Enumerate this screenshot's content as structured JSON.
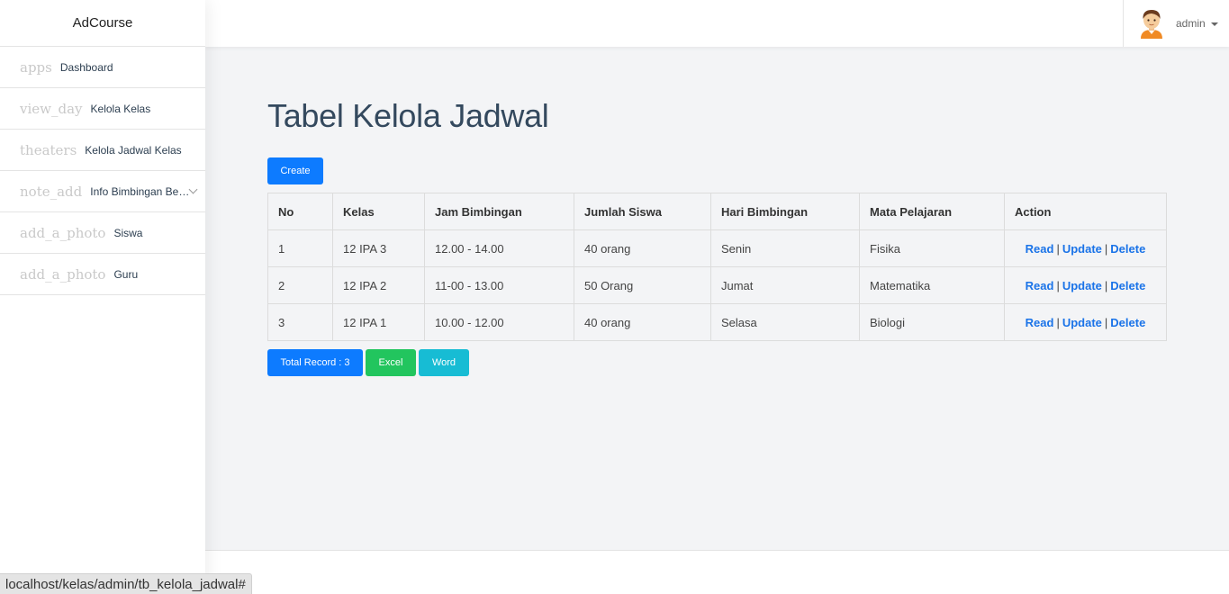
{
  "sidebar": {
    "brand": "AdCourse",
    "items": [
      {
        "icon": "apps",
        "label": "Dashboard"
      },
      {
        "icon": "view_day",
        "label": "Kelola Kelas"
      },
      {
        "icon": "theaters",
        "label": "Kelola Jadwal Kelas"
      },
      {
        "icon": "note_add",
        "label": "Info Bimbingan Belajar"
      },
      {
        "icon": "add_a_photo",
        "label": "Siswa"
      },
      {
        "icon": "add_a_photo",
        "label": "Guru"
      }
    ]
  },
  "topbar": {
    "user_name": "admin"
  },
  "main": {
    "title": "Tabel Kelola Jadwal",
    "create_label": "Create",
    "table": {
      "headers": [
        "No",
        "Kelas",
        "Jam Bimbingan",
        "Jumlah Siswa",
        "Hari Bimbingan",
        "Mata Pelajaran",
        "Action"
      ],
      "rows": [
        [
          "1",
          "12 IPA 3",
          "12.00 - 14.00",
          "40 orang",
          "Senin",
          "Fisika"
        ],
        [
          "2",
          "12 IPA 2",
          "11-00 - 13.00",
          "50 Orang",
          "Jumat",
          "Matematika"
        ],
        [
          "3",
          "12 IPA 1",
          "10.00 - 12.00",
          "40 orang",
          "Selasa",
          "Biologi"
        ]
      ],
      "actions": {
        "read": "Read",
        "update": "Update",
        "delete": "Delete",
        "separator": "|"
      }
    },
    "total_label": "Total Record : 3",
    "excel_label": "Excel",
    "word_label": "Word"
  },
  "status_url": "localhost/kelas/admin/tb_kelola_jadwal#",
  "colors": {
    "primary": "#0d7bff",
    "success": "#22c55e",
    "info": "#17bcd4",
    "link": "#1a73e8",
    "title": "#34495e"
  }
}
